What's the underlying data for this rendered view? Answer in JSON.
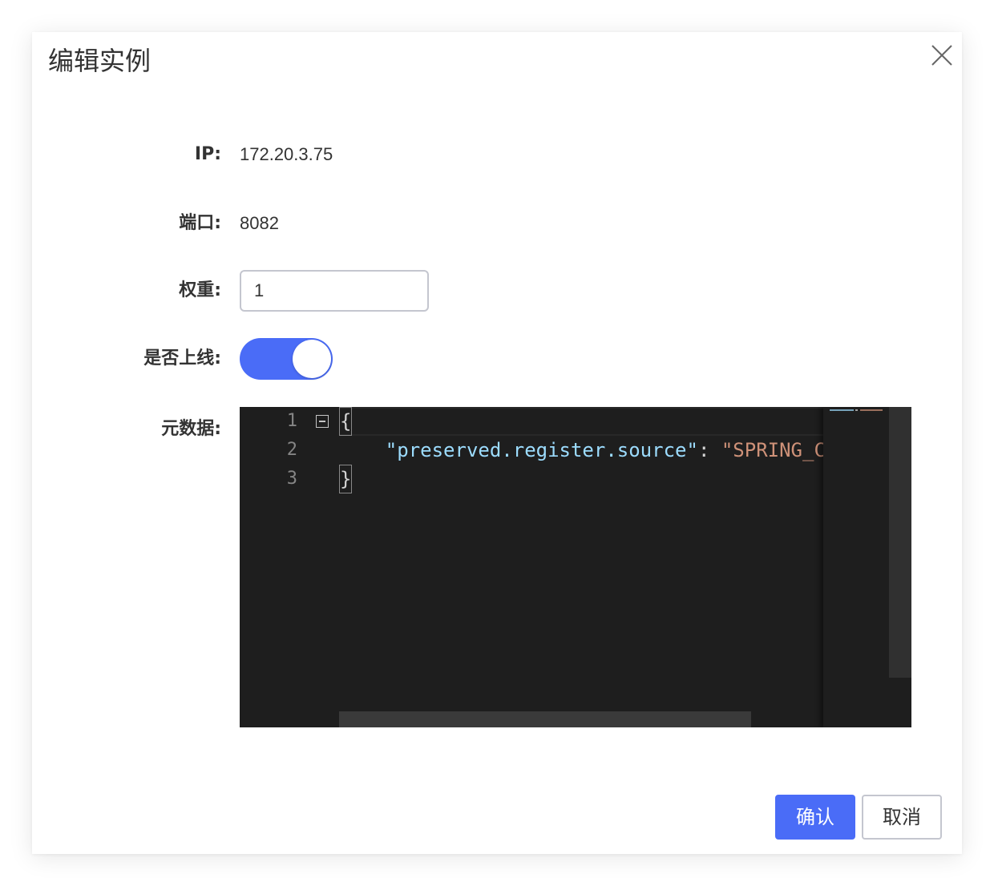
{
  "dialog": {
    "title": "编辑实例",
    "close_icon": "close-icon"
  },
  "form": {
    "ip_label": "IP:",
    "ip_value": "172.20.3.75",
    "port_label": "端口:",
    "port_value": "8082",
    "weight_label": "权重:",
    "weight_value": "1",
    "online_label": "是否上线:",
    "online_enabled": true,
    "metadata_label": "元数据:"
  },
  "editor": {
    "line_numbers": [
      "1",
      "2",
      "3"
    ],
    "open_brace": "{",
    "indent": "    ",
    "key": "\"preserved.register.source\"",
    "colon": ": ",
    "value": "\"SPRING_C",
    "close_brace": "}",
    "minimap_text": "\"preserved.register.source\": \"SPRING_"
  },
  "footer": {
    "confirm_label": "确认",
    "cancel_label": "取消"
  },
  "colors": {
    "accent": "#4a6cf7",
    "editor_bg": "#1e1e1e",
    "json_key": "#9cdcfe",
    "json_string": "#ce9178"
  }
}
